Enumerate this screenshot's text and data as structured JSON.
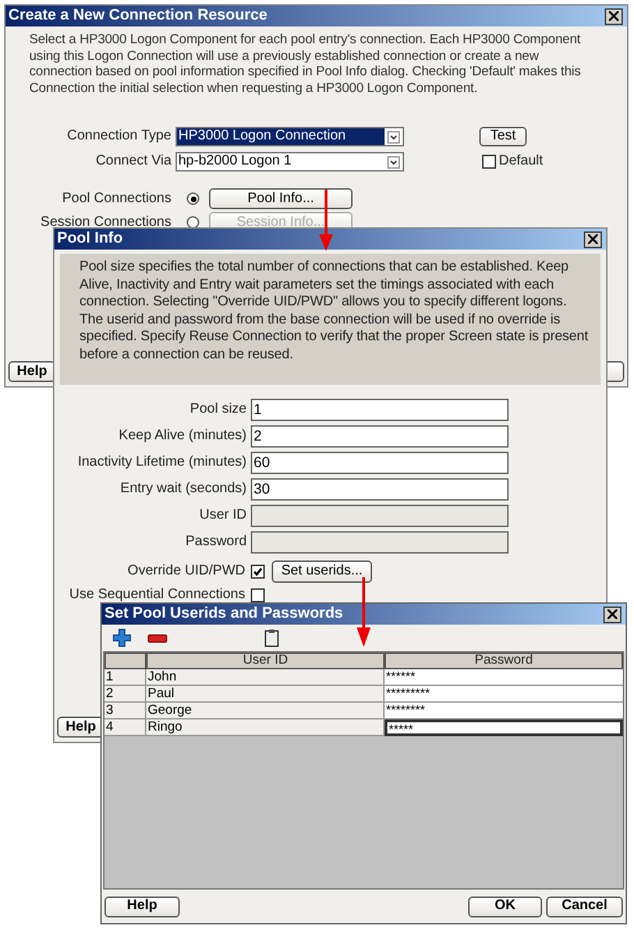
{
  "main_dialog": {
    "title": "Create a New Connection Resource",
    "description": "Select a HP3000 Logon Component for each pool entry's connection. Each HP3000 Component using this Logon Connection will use a previously established connection or create a new connection based on pool information specified in Pool Info dialog. Checking 'Default' makes this Connection the initial selection when requesting a HP3000 Logon Component.",
    "fields": [
      {
        "label": "Connection Type",
        "value": "HP3000 Logon Connection",
        "focused": true
      },
      {
        "label": "Connect Via",
        "value": "hp-b2000 Logon 1",
        "focused": false
      }
    ],
    "test_button": "Test",
    "default_checkbox": {
      "label": "Default",
      "checked": false
    },
    "modes": [
      {
        "label": "Pool Connections",
        "selected": true,
        "button": "Pool Info..."
      },
      {
        "label": "Session Connections",
        "selected": false,
        "button": "Session Info..."
      }
    ],
    "help_button": "Help"
  },
  "pool_info_dialog": {
    "title": "Pool Info",
    "description": "Pool size specifies the total number of connections that can be established.  Keep Alive, Inactivity and Entry wait parameters set the timings associated with each connection.  Selecting \"Override UID/PWD\" allows you to specify different logons. The userid and password from the base connection will be used if no override is specified. Specify Reuse Connection to verify that the proper Screen state is present before a connection can be reused.",
    "fields": [
      {
        "label": "Pool size",
        "value": "1",
        "disabled": false
      },
      {
        "label": "Keep Alive (minutes)",
        "value": "2",
        "disabled": false
      },
      {
        "label": "Inactivity Lifetime (minutes)",
        "value": "60",
        "disabled": false
      },
      {
        "label": "Entry wait (seconds)",
        "value": "30",
        "disabled": false
      },
      {
        "label": "User ID",
        "disabled": true
      },
      {
        "label": "Password",
        "disabled": true
      }
    ],
    "override": {
      "label": "Override UID/PWD",
      "checked": true,
      "button": "Set userids..."
    },
    "sequential": {
      "label": "Use Sequential Connections",
      "checked": false
    },
    "help_button": "Help"
  },
  "userids_dialog": {
    "title": "Set Pool Userids and Passwords",
    "columns": [
      "User ID",
      "Password"
    ],
    "rows": [
      {
        "index": "1",
        "user_id": "John",
        "password": "******",
        "editing": false
      },
      {
        "index": "2",
        "user_id": "Paul",
        "password": "*********",
        "editing": false
      },
      {
        "index": "3",
        "user_id": "George",
        "password": "********",
        "editing": false
      },
      {
        "index": "4",
        "user_id": "Ringo",
        "password": "*****",
        "editing": true
      }
    ],
    "buttons": [
      "Help",
      "OK",
      "Cancel"
    ]
  }
}
